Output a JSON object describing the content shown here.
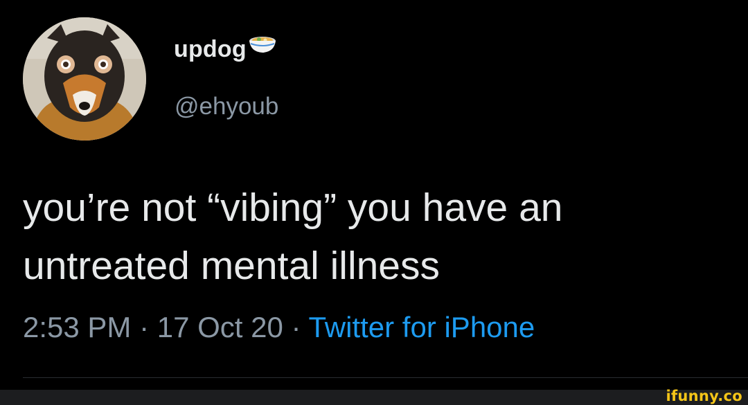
{
  "tweet": {
    "display_name": "updog",
    "badge_icon": "ramen-bowl-icon",
    "handle": "@ehyoub",
    "text": "you’re not “vibing” you have an\nuntreated mental illness",
    "time": "2:53 PM",
    "date": "17 Oct 20",
    "source": "Twitter for iPhone"
  },
  "watermark": "ifunny.co",
  "colors": {
    "background": "#000000",
    "text": "#e7e9ea",
    "secondary_text": "#8b98a5",
    "link": "#1d9bf0",
    "watermark": "#f5c518"
  }
}
